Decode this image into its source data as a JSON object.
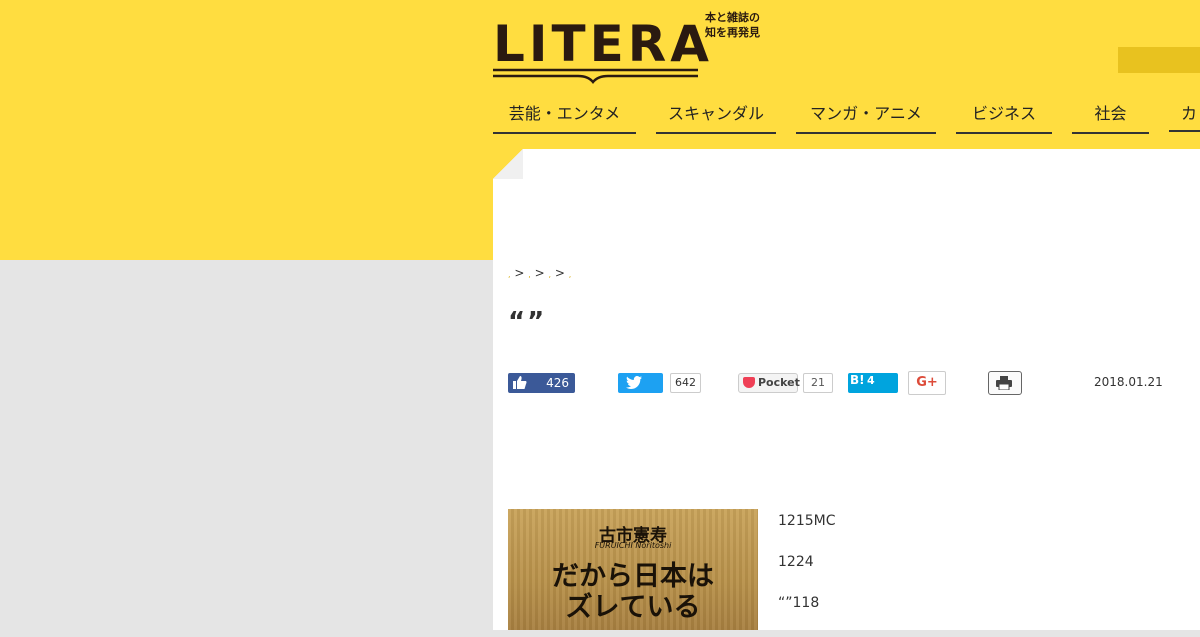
{
  "logo": {
    "text": "LITERA",
    "tagline_line1": "本と雑誌の",
    "tagline_line2": "知を再発見"
  },
  "nav": {
    "items": [
      {
        "label": "芸能・エンタメ"
      },
      {
        "label": "スキャンダル"
      },
      {
        "label": "マンガ・アニメ"
      },
      {
        "label": "ビジネス"
      },
      {
        "label": "社会"
      },
      {
        "label": "カ"
      }
    ]
  },
  "breadcrumb": {
    "separator": ">"
  },
  "article": {
    "title": "“”",
    "date": "2018.01.21",
    "paragraphs": [
      "1215MC",
      "1224",
      "“”118"
    ]
  },
  "share": {
    "facebook_count": "426",
    "twitter_count": "642",
    "pocket_label": "Pocket",
    "pocket_count": "21",
    "hatena_label": "B!",
    "hatena_count": "4",
    "gplus_label": "G+"
  },
  "book": {
    "author": "古市憲寿",
    "author_en": "FURUICHI Noritoshi",
    "title_line1": "だから日本は",
    "title_line2": "ズレている"
  },
  "colors": {
    "brand_yellow": "#ffdd40",
    "facebook": "#3b5998",
    "twitter": "#1da1f2",
    "hatena": "#00a4de",
    "pocket": "#ef4056"
  }
}
